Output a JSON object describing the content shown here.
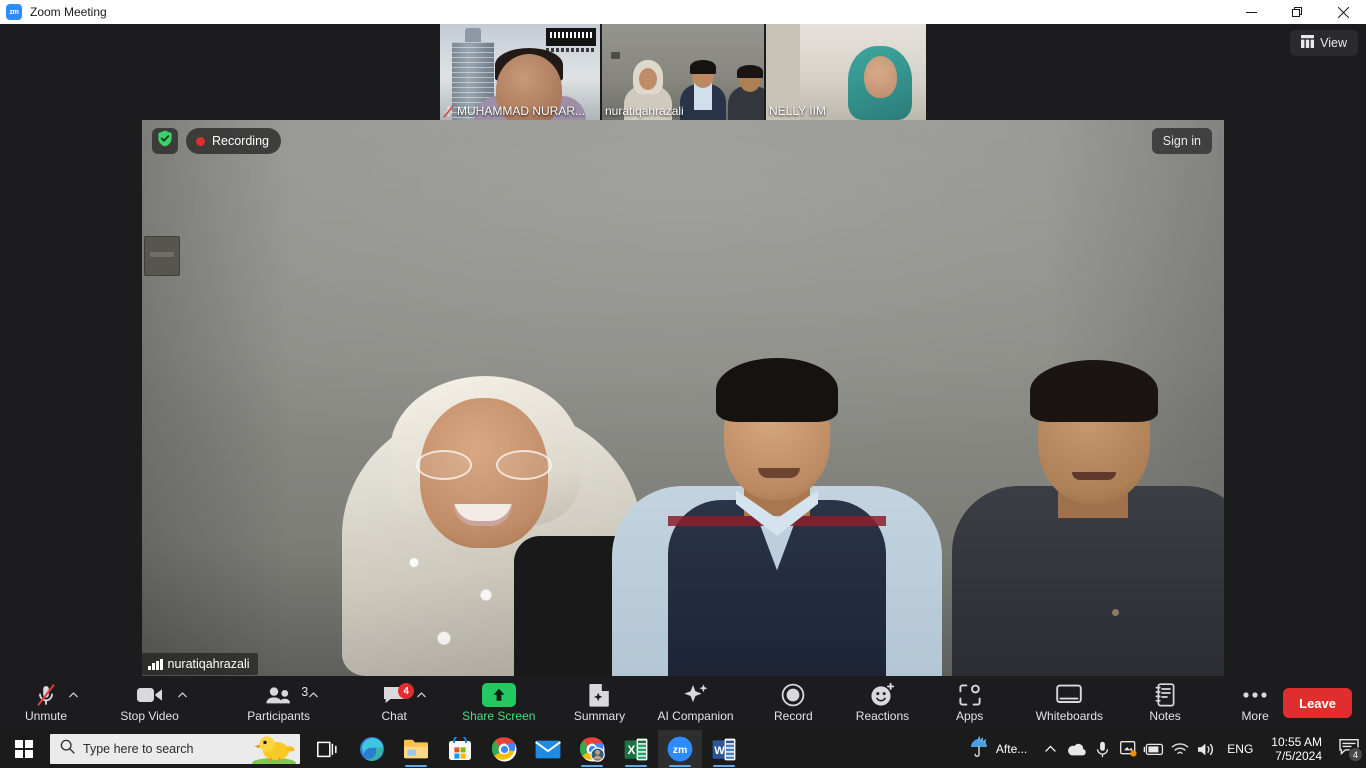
{
  "window": {
    "title": "Zoom Meeting",
    "app_logo_text": "zm",
    "controls": {
      "minimize": "minimize-button",
      "restore": "restore-button",
      "close": "close-button"
    }
  },
  "meeting": {
    "view_button": "View",
    "sign_in_button": "Sign in",
    "recording_label": "Recording",
    "encryption_icon": "shield-check-icon",
    "active_speaker_name": "nuratiqahrazali",
    "active_speaker_border_color": "#7ac143",
    "thumbnails": [
      {
        "name": "MUHAMMAD NURAR...",
        "muted": true,
        "active": false
      },
      {
        "name": "nuratiqahrazali",
        "muted": false,
        "active": true
      },
      {
        "name": "NELLY IIM",
        "muted": false,
        "active": false
      }
    ]
  },
  "toolbar": {
    "items": [
      {
        "label": "Unmute",
        "icon": "mic-muted-icon",
        "caret": true,
        "badge": null,
        "accent": false
      },
      {
        "label": "Stop Video",
        "icon": "video-camera-icon",
        "caret": true,
        "badge": null,
        "accent": false
      },
      {
        "label": "Participants",
        "icon": "participants-icon",
        "caret": true,
        "badge": "3",
        "accent": false
      },
      {
        "label": "Chat",
        "icon": "chat-bubble-icon",
        "caret": true,
        "badge": "4",
        "accent": false
      },
      {
        "label": "Share Screen",
        "icon": "share-screen-icon",
        "caret": false,
        "badge": null,
        "accent": true
      },
      {
        "label": "Summary",
        "icon": "summary-doc-icon",
        "caret": false,
        "badge": null,
        "accent": false
      },
      {
        "label": "AI Companion",
        "icon": "ai-sparkle-icon",
        "caret": false,
        "badge": null,
        "accent": false
      },
      {
        "label": "Record",
        "icon": "record-circle-icon",
        "caret": false,
        "badge": null,
        "accent": false
      },
      {
        "label": "Reactions",
        "icon": "reactions-smiley-icon",
        "caret": false,
        "badge": null,
        "accent": false
      },
      {
        "label": "Apps",
        "icon": "apps-icon",
        "caret": false,
        "badge": null,
        "accent": false
      },
      {
        "label": "Whiteboards",
        "icon": "whiteboard-icon",
        "caret": false,
        "badge": null,
        "accent": false
      },
      {
        "label": "Notes",
        "icon": "notes-icon",
        "caret": false,
        "badge": null,
        "accent": false
      },
      {
        "label": "More",
        "icon": "more-dots-icon",
        "caret": false,
        "badge": null,
        "accent": false
      }
    ],
    "leave_label": "Leave",
    "leave_color": "#e02d2d",
    "share_color": "#4ddb7a",
    "badge_color": "#e02d2d"
  },
  "taskbar": {
    "search_placeholder": "Type here to search",
    "apps": [
      {
        "name": "task-view",
        "running": false
      },
      {
        "name": "microsoft-edge",
        "running": false
      },
      {
        "name": "file-explorer",
        "running": true
      },
      {
        "name": "microsoft-store",
        "running": false
      },
      {
        "name": "google-chrome",
        "running": false
      },
      {
        "name": "mail",
        "running": false
      },
      {
        "name": "chrome-profile",
        "running": true
      },
      {
        "name": "microsoft-excel",
        "running": true
      },
      {
        "name": "zoom",
        "running": true
      },
      {
        "name": "microsoft-word",
        "running": true
      }
    ],
    "weather": "Afte...",
    "language": "ENG",
    "time": "10:55 AM",
    "date": "7/5/2024",
    "notification_count": "4"
  }
}
